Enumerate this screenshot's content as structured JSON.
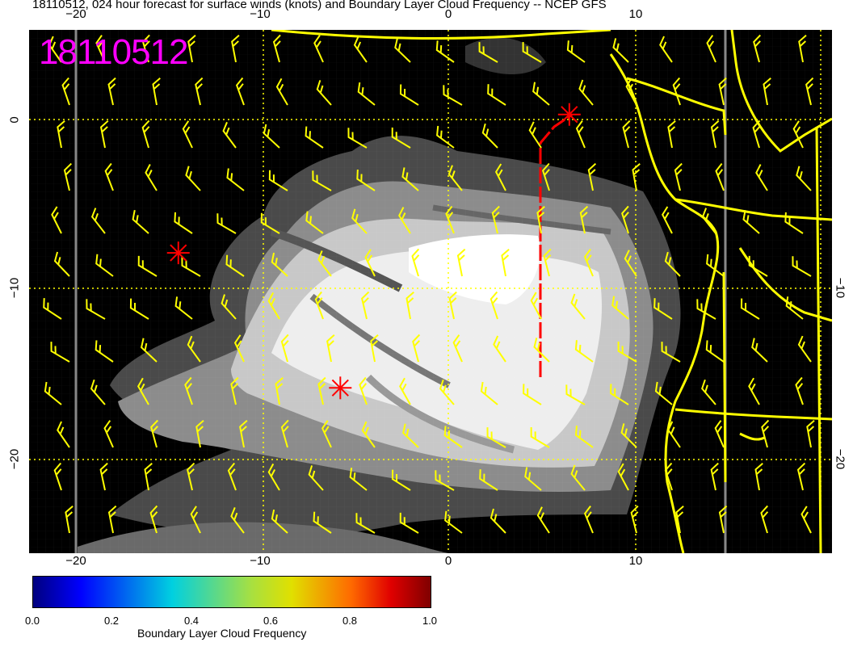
{
  "title": "18110512, 024 hour forecast for surface winds (knots) and Boundary Layer Cloud Frequency -- NCEP GFS",
  "date_stamp": "18110512",
  "axes": {
    "x_ticks_top": [
      "−20",
      "−10",
      "0",
      "10"
    ],
    "x_ticks_bottom": [
      "−20",
      "−10",
      "0",
      "10"
    ],
    "y_ticks_left": [
      "0",
      "−10",
      "−20"
    ],
    "y_ticks_right": [
      "−10",
      "−20"
    ]
  },
  "colorbar": {
    "title": "Boundary Layer Cloud Frequency",
    "labels": [
      "0.0",
      "0.2",
      "0.4",
      "0.6",
      "0.8",
      "1.0"
    ]
  },
  "colors": {
    "date_stamp": "#ff00ff",
    "coastline": "#ffff00",
    "wind_barbs": "#ffff00",
    "markers": "#ff0000",
    "grid": "#ffff00"
  },
  "markers": [
    {
      "name": "ship-marker",
      "lon": 6.5,
      "lat": 0.3
    },
    {
      "name": "ship-marker",
      "lon": -14.5,
      "lat": -7.9
    },
    {
      "name": "ship-marker",
      "lon": -5.8,
      "lat": -15.9
    }
  ]
}
